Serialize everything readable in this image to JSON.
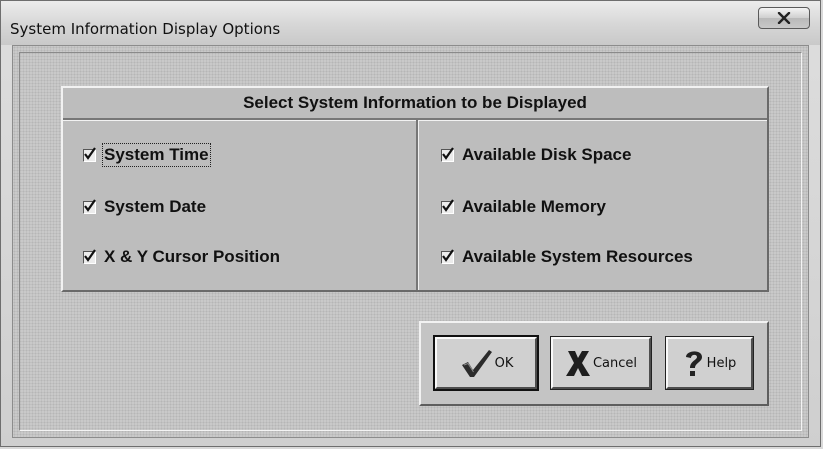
{
  "window": {
    "title": "System Information Display Options"
  },
  "panel": {
    "heading": "Select System Information to be Displayed",
    "left_options": [
      {
        "label": "System Time",
        "checked": true
      },
      {
        "label": "System Date",
        "checked": true
      },
      {
        "label": "X & Y Cursor Position",
        "checked": true
      }
    ],
    "right_options": [
      {
        "label": "Available Disk Space",
        "checked": true
      },
      {
        "label": "Available Memory",
        "checked": true
      },
      {
        "label": "Available System Resources",
        "checked": true
      }
    ]
  },
  "buttons": {
    "ok_label": "OK",
    "cancel_label": "Cancel",
    "help_label": "Help"
  },
  "icons": {
    "close": "close-icon",
    "ok": "checkmark-icon",
    "cancel": "x-icon",
    "help": "question-mark-icon"
  }
}
